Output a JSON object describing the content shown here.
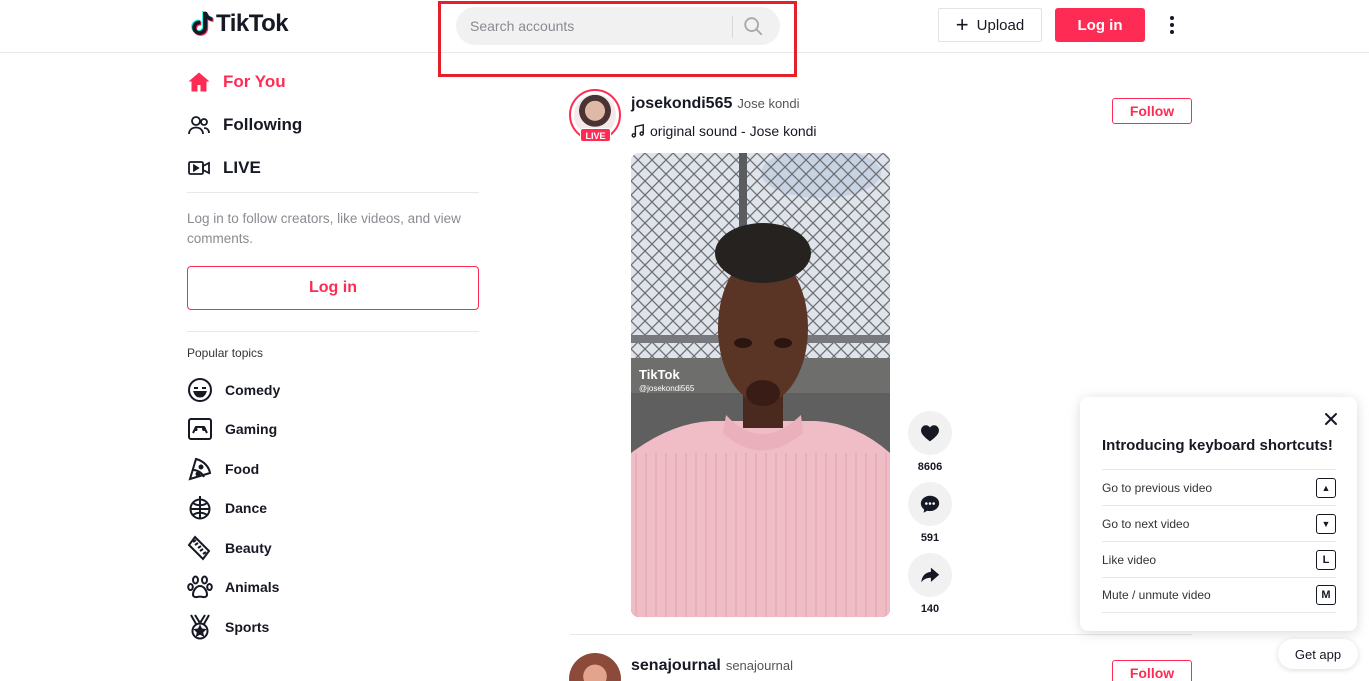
{
  "header": {
    "logo_text": "TikTok",
    "search_placeholder": "Search accounts",
    "upload_label": "Upload",
    "login_label": "Log in"
  },
  "sidebar": {
    "nav": [
      {
        "label": "For You",
        "icon": "home-icon",
        "active": true
      },
      {
        "label": "Following",
        "icon": "users-icon"
      },
      {
        "label": "LIVE",
        "icon": "live-video-icon"
      }
    ],
    "login_hint": "Log in to follow creators, like videos, and view comments.",
    "login_label": "Log in",
    "topics_title": "Popular topics",
    "topics": [
      {
        "label": "Comedy",
        "icon": "smile-icon"
      },
      {
        "label": "Gaming",
        "icon": "gamepad-icon"
      },
      {
        "label": "Food",
        "icon": "pizza-icon"
      },
      {
        "label": "Dance",
        "icon": "disco-ball-icon"
      },
      {
        "label": "Beauty",
        "icon": "comb-icon"
      },
      {
        "label": "Animals",
        "icon": "paw-icon"
      },
      {
        "label": "Sports",
        "icon": "medal-icon"
      }
    ]
  },
  "feed": {
    "posts": [
      {
        "username": "josekondi565",
        "nickname": "Jose kondi",
        "live_badge": "LIVE",
        "sound": "original sound - Jose kondi",
        "follow_label": "Follow",
        "watermark_logo": "TikTok",
        "watermark_user": "@josekondi565",
        "likes": "8606",
        "comments": "591",
        "shares": "140"
      },
      {
        "username": "senajournal",
        "nickname": "senajournal",
        "follow_label": "Follow"
      }
    ]
  },
  "keyboard_panel": {
    "title": "Introducing keyboard shortcuts!",
    "shortcuts": [
      {
        "label": "Go to previous video",
        "key": "▲"
      },
      {
        "label": "Go to next video",
        "key": "▼"
      },
      {
        "label": "Like video",
        "key": "L"
      },
      {
        "label": "Mute / unmute video",
        "key": "M"
      }
    ]
  },
  "get_app_label": "Get app",
  "colors": {
    "accent": "#fe2c55",
    "highlight_box": "#e3212b",
    "text": "#161823"
  }
}
